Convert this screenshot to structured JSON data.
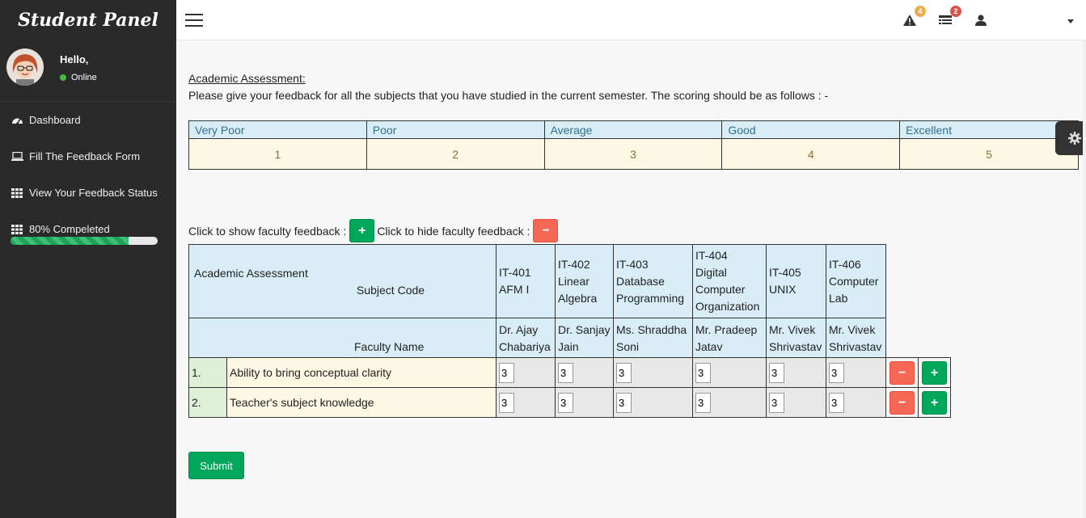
{
  "sidebar": {
    "brand": "Student Panel",
    "greeting": "Hello,",
    "status": "Online",
    "status_color": "#3fbf3f",
    "items": [
      {
        "label": "Dashboard",
        "icon": "dashboard-icon"
      },
      {
        "label": "Fill The Feedback Form",
        "icon": "laptop-icon"
      },
      {
        "label": "View Your Feedback Status",
        "icon": "grid-icon"
      },
      {
        "label": "80% Compeleted",
        "icon": "grid-icon"
      }
    ],
    "progress": 0.8
  },
  "topbar": {
    "alerts_count": "4",
    "alerts_color": "#f0ad4e",
    "tasks_count": "2",
    "tasks_color": "#d9534f"
  },
  "main": {
    "heading": "Academic Assessment: ",
    "intro": "Please give your feedback for all the subjects that you have studied in the current semester. The scoring should be as follows : -",
    "scale_labels": [
      "Very Poor",
      "Poor",
      "Average",
      "Good",
      "Excellent"
    ],
    "scale_values": [
      "1",
      "2",
      "3",
      "4",
      "5"
    ],
    "show_label": "Click to show faculty feedback :",
    "hide_label": "Click to hide faculty feedback :",
    "table": {
      "title": "Academic Assessment",
      "subject_code_label": "Subject Code",
      "faculty_name_label": "Faculty Name",
      "subjects": [
        {
          "code": "IT-401",
          "name": "AFM I",
          "faculty": "Dr. Ajay Chabariya"
        },
        {
          "code": "IT-402",
          "name": "Linear Algebra",
          "faculty": "Dr. Sanjay Jain"
        },
        {
          "code": "IT-403",
          "name": "Database Programming",
          "faculty": "Ms. Shraddha Soni"
        },
        {
          "code": "IT-404",
          "name": "Digital Computer Organization",
          "faculty": "Mr. Pradeep Jatav"
        },
        {
          "code": "IT-405",
          "name": "UNIX",
          "faculty": "Mr. Vivek Shrivastav"
        },
        {
          "code": "IT-406",
          "name": "Computer Lab",
          "faculty": "Mr. Vivek Shrivastav"
        }
      ],
      "rows": [
        {
          "num": "1.",
          "criterion": "Ability to bring conceptual clarity",
          "scores": [
            "3",
            "3",
            "3",
            "3",
            "3",
            "3"
          ]
        },
        {
          "num": "2.",
          "criterion": "Teacher's subject knowledge",
          "scores": [
            "3",
            "3",
            "3",
            "3",
            "3",
            "3"
          ]
        }
      ]
    },
    "submit_label": "Submit"
  }
}
